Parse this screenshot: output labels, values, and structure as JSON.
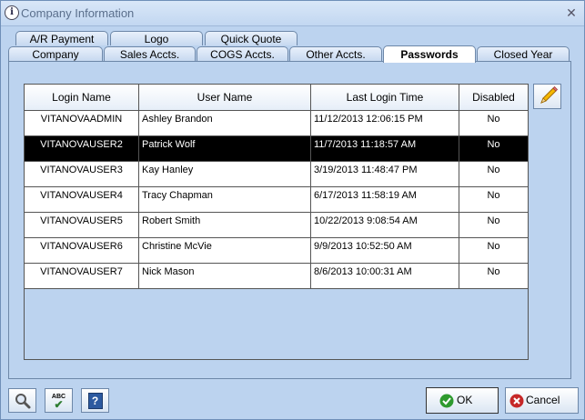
{
  "window": {
    "title": "Company Information",
    "close_glyph": "✕",
    "info_glyph": "i"
  },
  "tabs_row1": [
    {
      "label": "A/R Payment"
    },
    {
      "label": "Logo"
    },
    {
      "label": "Quick Quote"
    }
  ],
  "tabs_row2": [
    {
      "label": "Company"
    },
    {
      "label": "Sales Accts."
    },
    {
      "label": "COGS Accts."
    },
    {
      "label": "Other Accts."
    },
    {
      "label": "Passwords",
      "active": true
    },
    {
      "label": "Closed Year"
    }
  ],
  "table": {
    "columns": [
      "Login Name",
      "User Name",
      "Last Login Time",
      "Disabled"
    ],
    "rows": [
      {
        "login": "VITANOVAADMIN",
        "user": "Ashley Brandon",
        "last_login": "11/12/2013 12:06:15 PM",
        "disabled": "No"
      },
      {
        "login": "VITANOVAUSER2",
        "user": "Patrick Wolf",
        "last_login": "11/7/2013 11:18:57 AM",
        "disabled": "No",
        "selected": true
      },
      {
        "login": "VITANOVAUSER3",
        "user": "Kay Hanley",
        "last_login": "3/19/2013 11:48:47 PM",
        "disabled": "No"
      },
      {
        "login": "VITANOVAUSER4",
        "user": "Tracy Chapman",
        "last_login": "6/17/2013 11:58:19 AM",
        "disabled": "No"
      },
      {
        "login": "VITANOVAUSER5",
        "user": "Robert Smith",
        "last_login": "10/22/2013 9:08:54 AM",
        "disabled": "No"
      },
      {
        "login": "VITANOVAUSER6",
        "user": "Christine McVie",
        "last_login": "9/9/2013 10:52:50 AM",
        "disabled": "No"
      },
      {
        "login": "VITANOVAUSER7",
        "user": "Nick Mason",
        "last_login": "8/6/2013 10:00:31 AM",
        "disabled": "No"
      }
    ]
  },
  "buttons": {
    "ok": "OK",
    "cancel": "Cancel",
    "help_glyph": "?",
    "spell_glyph": "ABC"
  },
  "icons": [
    "info-icon",
    "close-icon",
    "pencil-icon",
    "search-icon",
    "spellcheck-icon",
    "help-icon",
    "checkmark-icon",
    "cancel-icon"
  ],
  "colors": {
    "background": "#bcd3ef",
    "selected_row": "#000000",
    "ok_green": "#2e9a2e",
    "cancel_red": "#c62828"
  }
}
